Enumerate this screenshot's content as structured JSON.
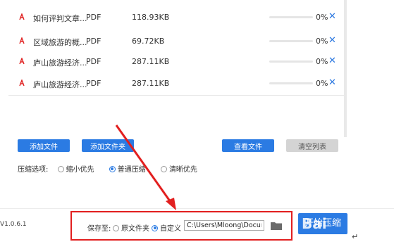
{
  "files": [
    {
      "name": "如何评判文章...",
      "type": "PDF",
      "size": "118.93KB",
      "progress": 0,
      "percent": "0%"
    },
    {
      "name": "区域旅游的概...",
      "type": "PDF",
      "size": "69.72KB",
      "progress": 0,
      "percent": "0%"
    },
    {
      "name": "庐山旅游经济...",
      "type": "PDF",
      "size": "287.11KB",
      "progress": 0,
      "percent": "0%"
    },
    {
      "name": "庐山旅游经济...",
      "type": "PDF",
      "size": "287.11KB",
      "progress": 0,
      "percent": "0%"
    }
  ],
  "toolbar": {
    "add_file": "添加文件",
    "add_folder": "添加文件夹",
    "view_file": "查看文件",
    "clear_list": "清空列表"
  },
  "compress": {
    "label": "压缩选项:",
    "options": [
      "缩小优先",
      "普通压缩",
      "清晰优先"
    ],
    "selected": "普通压缩"
  },
  "save": {
    "label": "保存至:",
    "source_folder": "原文件夹",
    "custom": "自定义",
    "selected": "自定义",
    "path": "C:\\Users\\Mloong\\Documents"
  },
  "version": "V1.0.6.1",
  "start_label": "开始压缩",
  "watermark": "Bai",
  "colors": {
    "accent": "#2b7be3",
    "highlight": "#e21f1f"
  }
}
